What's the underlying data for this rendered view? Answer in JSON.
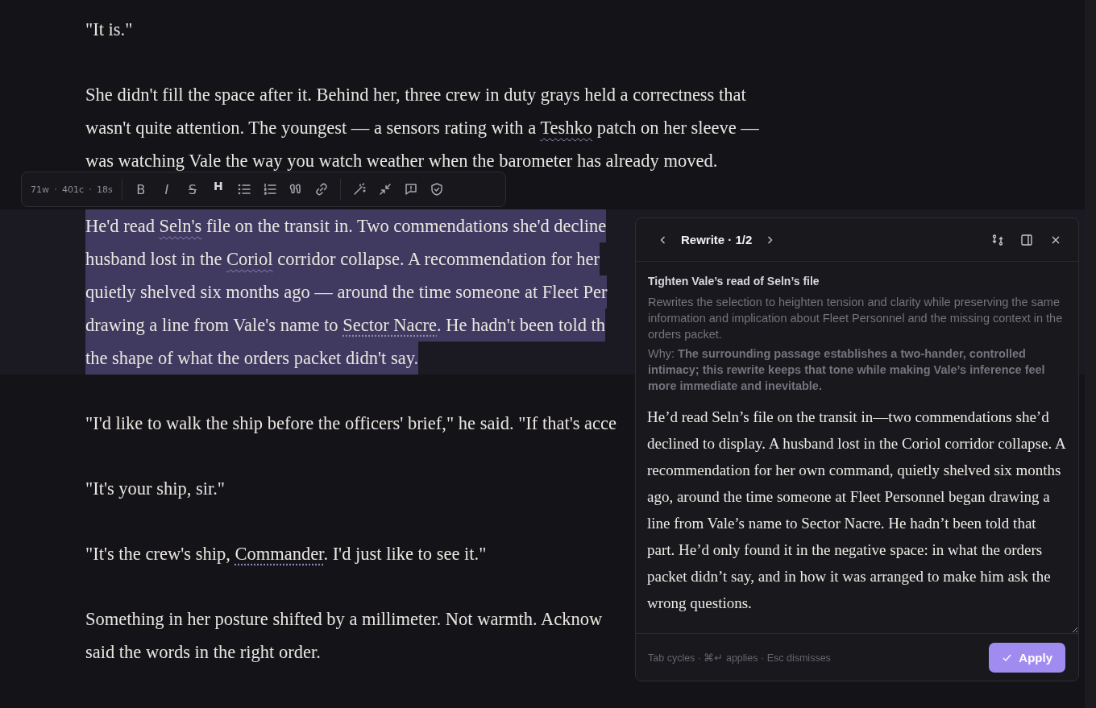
{
  "editor": {
    "paragraphs": [
      {
        "selected": false,
        "lines": [
          [
            {
              "text": "\"It is.\"",
              "kind": "plain"
            }
          ]
        ]
      },
      {
        "selected": false,
        "lines": [
          [
            {
              "text": "She didn't fill the space after it. Behind her, three crew in duty grays held a correctness that",
              "kind": "plain"
            }
          ],
          [
            {
              "text": "wasn't quite attention. The youngest — a sensors rating with a ",
              "kind": "plain"
            },
            {
              "text": "Teshko",
              "kind": "wavy"
            },
            {
              "text": " patch on her sleeve —",
              "kind": "plain"
            }
          ],
          [
            {
              "text": "was watching Vale the way you watch weather when the barometer has already moved.",
              "kind": "plain"
            }
          ]
        ]
      },
      {
        "selected": true,
        "lines": [
          [
            {
              "text": "He'd read ",
              "kind": "plain"
            },
            {
              "text": "Seln's",
              "kind": "wavy"
            },
            {
              "text": " file on the transit in. Two commendations she'd decline",
              "kind": "plain"
            }
          ],
          [
            {
              "text": "husband lost in the ",
              "kind": "plain"
            },
            {
              "text": "Coriol",
              "kind": "wavy"
            },
            {
              "text": " corridor collapse. A recommendation for her",
              "kind": "plain"
            }
          ],
          [
            {
              "text": "quietly shelved six months ago — around the time someone at Fleet Per",
              "kind": "plain"
            }
          ],
          [
            {
              "text": "drawing a line from Vale's name to ",
              "kind": "plain"
            },
            {
              "text": "Sector Nacre",
              "kind": "dotted"
            },
            {
              "text": ". He hadn't been told th",
              "kind": "plain"
            }
          ],
          [
            {
              "text": "the shape of what the orders packet didn't say.",
              "kind": "plain"
            }
          ]
        ]
      },
      {
        "selected": false,
        "lines": [
          [
            {
              "text": "\"I'd like to walk the ship before the officers' brief,\" he said. \"If that's acce",
              "kind": "plain"
            }
          ]
        ]
      },
      {
        "selected": false,
        "lines": [
          [
            {
              "text": "\"It's your ship, sir.\"",
              "kind": "plain"
            }
          ]
        ]
      },
      {
        "selected": false,
        "lines": [
          [
            {
              "text": "\"It's the crew's ship, ",
              "kind": "plain"
            },
            {
              "text": "Commander",
              "kind": "dotted"
            },
            {
              "text": ". I'd just like to see it.\"",
              "kind": "plain"
            }
          ]
        ]
      },
      {
        "selected": false,
        "lines": [
          [
            {
              "text": "Something in her posture shifted by a millimeter. Not warmth. Acknow",
              "kind": "plain"
            }
          ],
          [
            {
              "text": "said the words in the right order.",
              "kind": "plain"
            }
          ]
        ]
      }
    ]
  },
  "toolbar": {
    "stats": [
      "71w",
      "401c",
      "18s"
    ],
    "groups": [
      [
        {
          "kind": "bold",
          "label": "B"
        },
        {
          "kind": "italic",
          "label": "I"
        },
        {
          "kind": "strike",
          "label": "S"
        },
        {
          "kind": "heading",
          "label": "H"
        },
        {
          "kind": "bullets"
        },
        {
          "kind": "numbers"
        },
        {
          "kind": "quote"
        },
        {
          "kind": "link"
        }
      ],
      [
        {
          "kind": "wand"
        },
        {
          "kind": "collapse"
        },
        {
          "kind": "comment"
        },
        {
          "kind": "shield"
        }
      ]
    ]
  },
  "panel": {
    "title": "Rewrite · 1/2",
    "heading": "Tighten Vale’s read of Seln’s file",
    "description": "Rewrites the selection to heighten tension and clarity while preserving the same information and implication about Fleet Personnel and the missing context in the orders packet.",
    "why": "Why: **The surrounding passage establishes a two-hander, controlled intimacy; this rewrite keeps that tone while making Vale’s inference feel more immediate and inevitable.**",
    "rewrite": "He’d read Seln’s file on the transit in—two commendations she’d declined to display. A husband lost in the Coriol corridor collapse. A recommendation for her own command, quietly shelved six months ago, around the time someone at Fleet Personnel began drawing a line from Vale’s name to Sector Nacre. He hadn’t been told that part. He’d only found it in the negative space: in what the orders packet didn’t say, and in how it was arranged to make him ask the wrong questions.",
    "hint": "Tab cycles · ⌘↵ applies · Esc dismisses",
    "apply": "Apply"
  }
}
